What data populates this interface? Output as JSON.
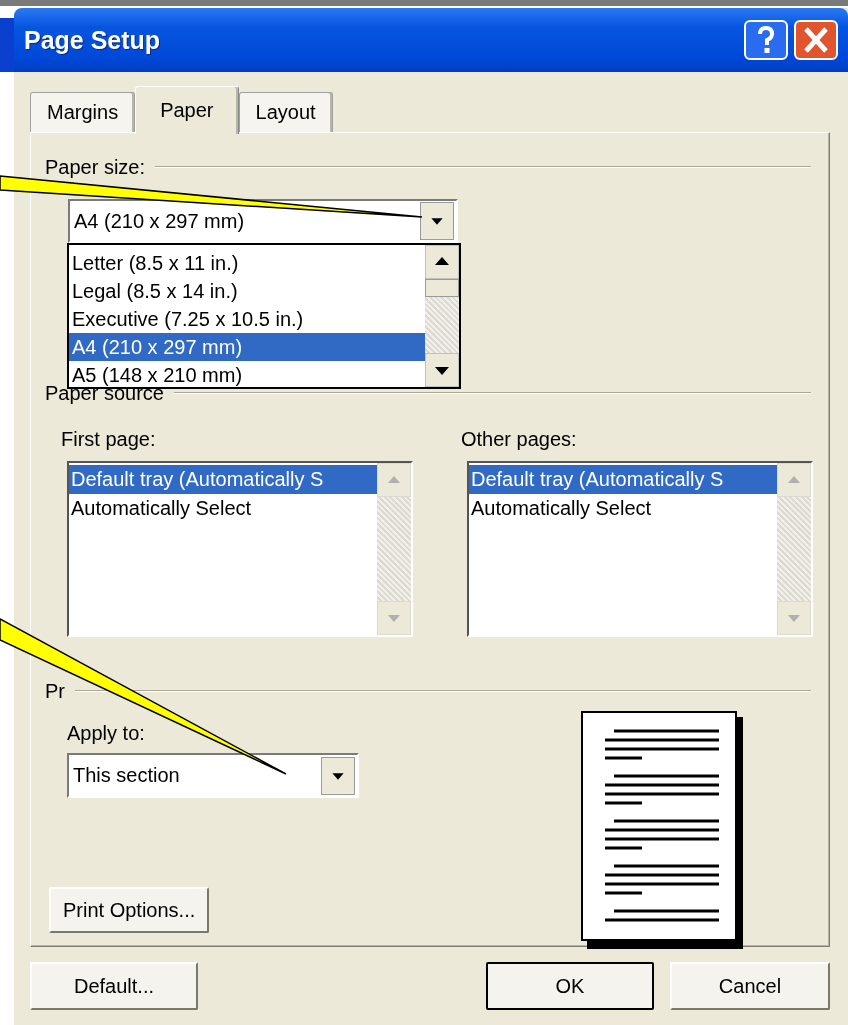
{
  "window": {
    "title": "Page Setup"
  },
  "tabs": [
    {
      "label": "Margins",
      "selected": false
    },
    {
      "label": "Paper",
      "selected": true
    },
    {
      "label": "Layout",
      "selected": false
    }
  ],
  "paper_size": {
    "label": "Paper size:",
    "value": "A4 (210 x 297 mm)",
    "options": [
      {
        "label": "Letter (8.5 x 11 in.)",
        "selected": false
      },
      {
        "label": "Legal (8.5 x 14 in.)",
        "selected": false
      },
      {
        "label": "Executive (7.25 x 10.5 in.)",
        "selected": false
      },
      {
        "label": "A4 (210 x 297 mm)",
        "selected": true
      },
      {
        "label": "A5 (148 x 210 mm)",
        "selected": false
      }
    ]
  },
  "paper_source": {
    "label": "Paper source",
    "lists": [
      {
        "label": "First page:",
        "items": [
          {
            "label": "Default tray (Automatically S",
            "selected": true
          },
          {
            "label": "Automatically Select",
            "selected": false
          }
        ]
      },
      {
        "label": "Other pages:",
        "items": [
          {
            "label": "Default tray (Automatically S",
            "selected": true
          },
          {
            "label": "Automatically Select",
            "selected": false
          }
        ]
      }
    ]
  },
  "preview": {
    "label": "Pr",
    "apply_to": {
      "label": "Apply to:",
      "value": "This section"
    },
    "print_options_button": "Print Options..."
  },
  "buttons": [
    {
      "label": "Default...",
      "kind": "default"
    },
    {
      "label": "OK",
      "kind": "ok"
    },
    {
      "label": "Cancel",
      "kind": "cancel"
    }
  ]
}
